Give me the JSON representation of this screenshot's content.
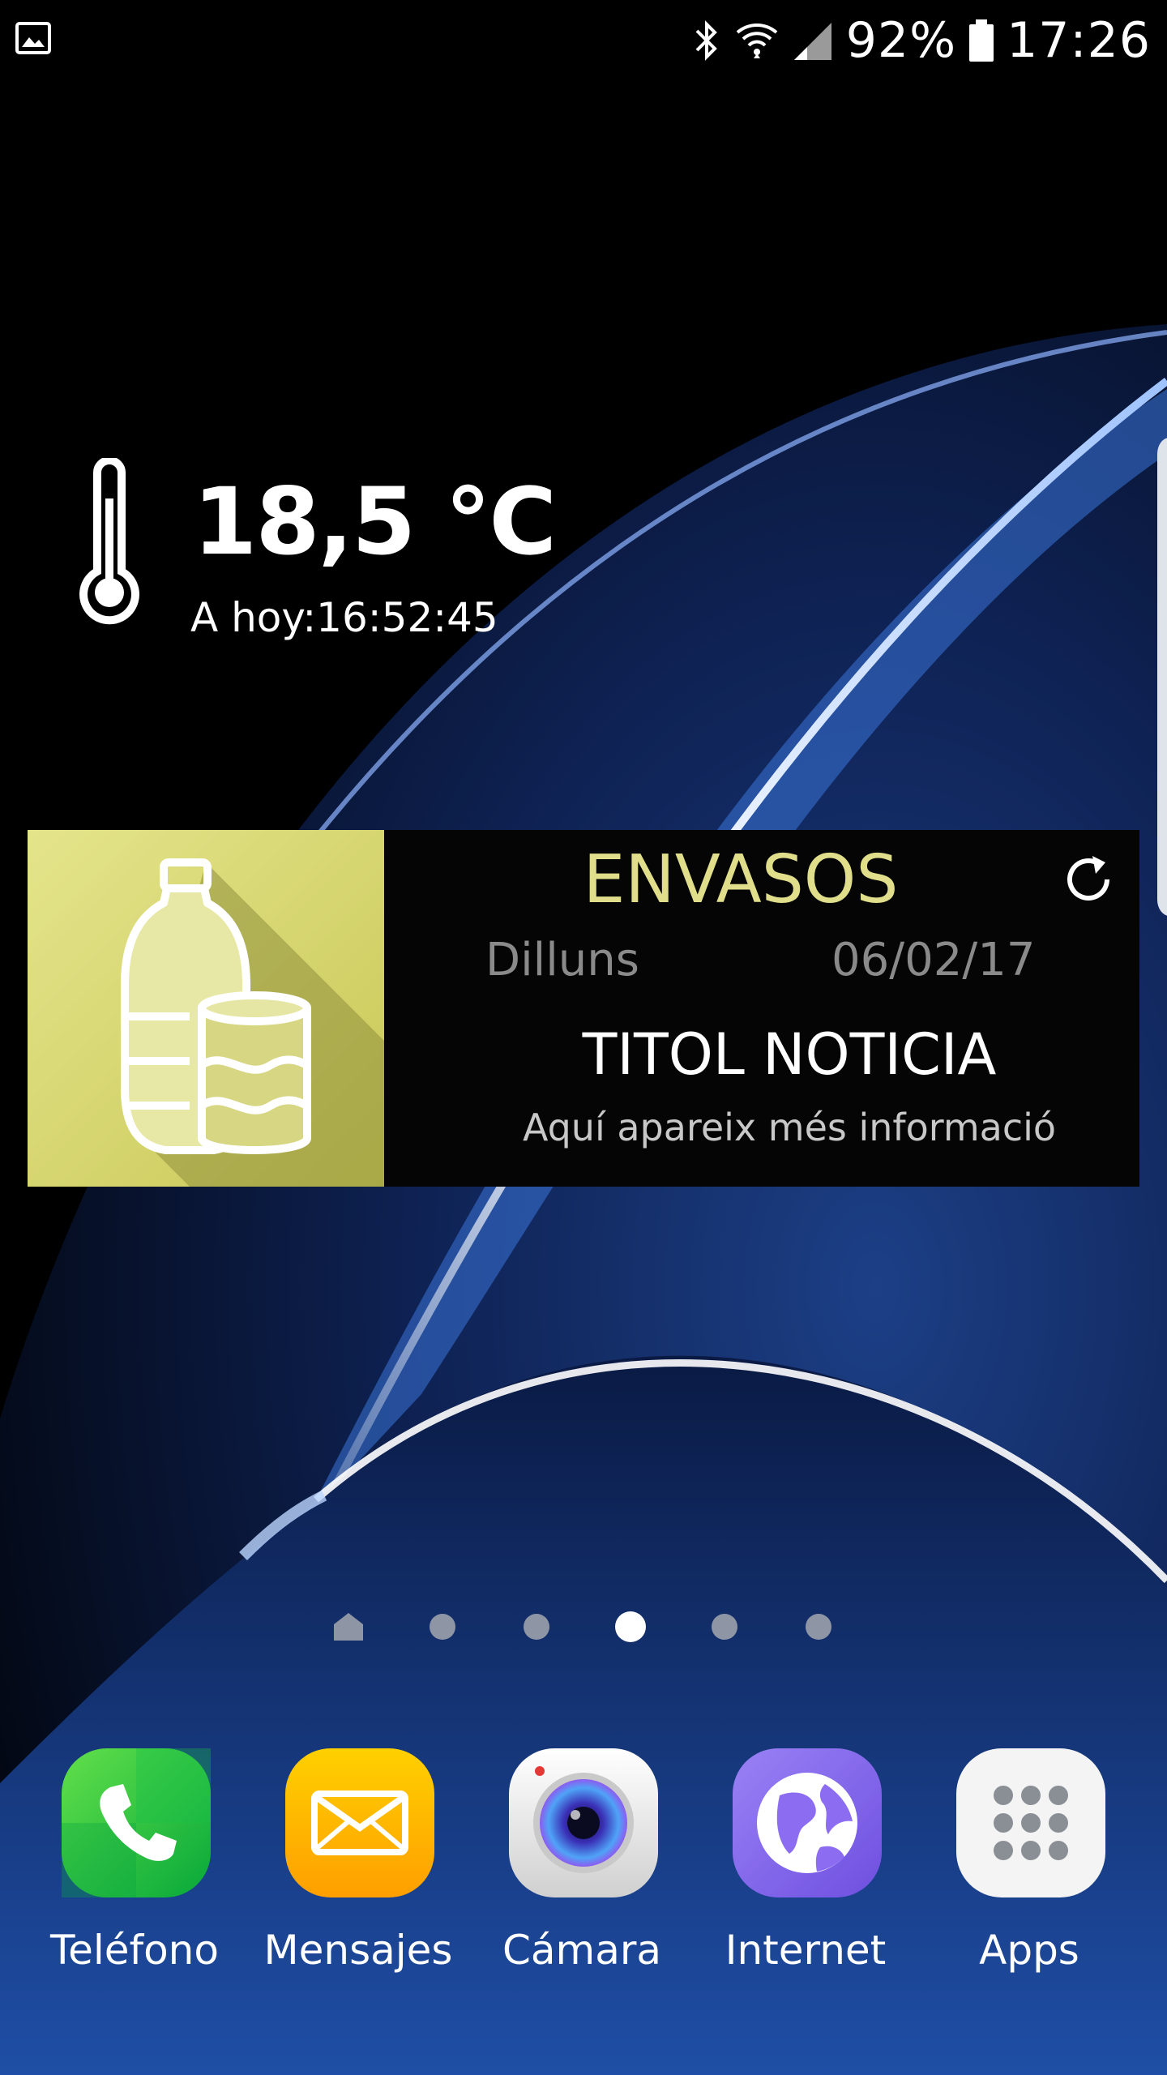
{
  "status_bar": {
    "battery_text": "92%",
    "time": "17:26",
    "icons": [
      "gallery-icon",
      "bluetooth-icon",
      "wifi-icon",
      "signal-icon",
      "battery-icon"
    ]
  },
  "weather_widget": {
    "temperature": "18,5 ℃",
    "updated_text": "A hoy:16:52:45",
    "icon": "thermometer-icon"
  },
  "news_widget": {
    "category": "ENVASOS",
    "day": "Dilluns",
    "date": "06/02/17",
    "title": "TITOL NOTICIA",
    "info": "Aquí apareix més informació",
    "thumbnail_icon": "bottle-and-can-icon",
    "refresh_icon": "refresh-icon",
    "accent_color": "#e0de8a",
    "thumb_color": "#d9d977"
  },
  "page_indicator": {
    "page_count": 6,
    "active_page": 4,
    "home_icon": "home-icon"
  },
  "dock": {
    "apps": [
      {
        "label": "Teléfono",
        "icon": "phone-icon",
        "color": "#19c93a"
      },
      {
        "label": "Mensajes",
        "icon": "message-icon",
        "color": "#ffb300"
      },
      {
        "label": "Cámara",
        "icon": "camera-icon",
        "color": "#e8e8e8"
      },
      {
        "label": "Internet",
        "icon": "globe-icon",
        "color": "#8c6cf0"
      },
      {
        "label": "Apps",
        "icon": "apps-grid-icon",
        "color": "#f2f2f2"
      }
    ]
  }
}
